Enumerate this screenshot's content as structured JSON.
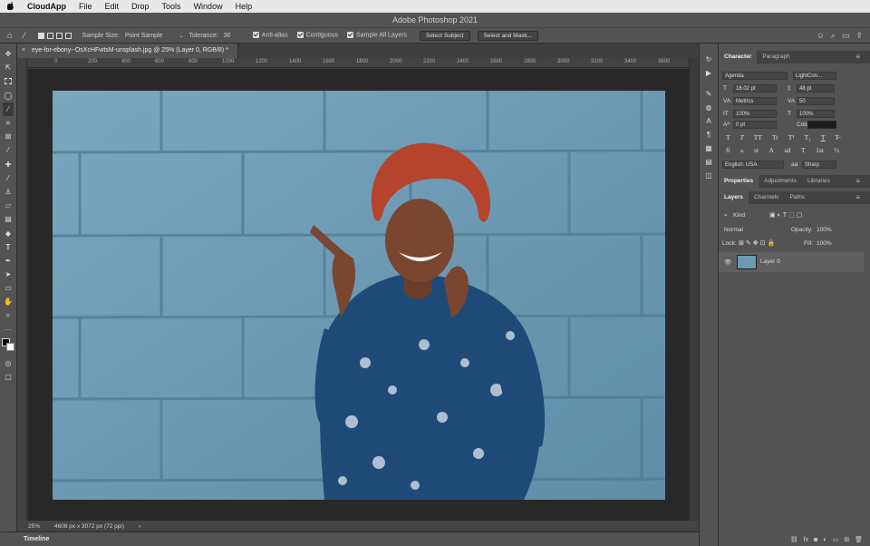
{
  "menubar": {
    "apple": "",
    "app": "CloudApp",
    "items": [
      "File",
      "Edit",
      "Drop",
      "Tools",
      "Window",
      "Help"
    ]
  },
  "window": {
    "title": "Adobe Photoshop 2021"
  },
  "options_bar": {
    "sample_size_label": "Sample Size:",
    "sample_size_value": "Point Sample",
    "tolerance_label": "Tolerance:",
    "tolerance_value": "30",
    "anti_alias": "Anti-alias",
    "contiguous": "Contiguous",
    "sample_all_layers": "Sample All Layers",
    "select_subject": "Select Subject",
    "select_and_mask": "Select and Mask..."
  },
  "document": {
    "tab_title": "eye-for-ebony--OsXcHFwtsM-unsplash.jpg @ 25% (Layer 0, RGB/8) *",
    "close": "×",
    "ruler_ticks": [
      "0",
      "200",
      "400",
      "600",
      "800",
      "1000",
      "1200",
      "1400",
      "1600",
      "1800",
      "2000",
      "2200",
      "2400",
      "2600",
      "2800",
      "3000",
      "3200",
      "3400",
      "3600"
    ]
  },
  "status_bar": {
    "zoom": "25%",
    "doc_info": "4608 px x 3072 px (72 ppi)",
    "arrow": "›"
  },
  "timeline": {
    "label": "Timeline"
  },
  "character_panel": {
    "tabs": [
      "Character",
      "Paragraph"
    ],
    "font_family": "Agenda",
    "font_style": "LightCon...",
    "font_size": "16.02 pt",
    "leading": "48 pt",
    "kerning": "Metrics",
    "tracking": "50",
    "vertical_scale": "100%",
    "horizontal_scale": "100%",
    "baseline_shift": "0 pt",
    "color_label": "Color:",
    "color_value": "#1c1c1c",
    "format_buttons": [
      "T",
      "T",
      "TT",
      "Tr",
      "T¹",
      "T₁",
      "T",
      "T̶"
    ],
    "opentype_buttons": [
      "fi",
      "ℴ",
      "st",
      "A",
      "ad",
      "T",
      "1st",
      "½"
    ],
    "language": "English: USA",
    "aa_symbol": "aa",
    "antialias": "Sharp"
  },
  "properties_panel": {
    "tabs": [
      "Properties",
      "Adjustments",
      "Libraries"
    ]
  },
  "layers_panel": {
    "tabs": [
      "Layers",
      "Channels",
      "Paths"
    ],
    "filter_kind": "Kind",
    "blend_mode": "Normal",
    "opacity_label": "Opacity:",
    "opacity_value": "100%",
    "lock_label": "Lock:",
    "fill_label": "Fill:",
    "fill_value": "100%",
    "layers": [
      {
        "name": "Layer 0",
        "visible": true
      }
    ]
  },
  "colors": {
    "ui_bg": "#535353",
    "canvas_bg": "#282828",
    "wall_blue": "#6c9ab3",
    "hair": "#b5442c",
    "dress": "#1f4a78"
  }
}
